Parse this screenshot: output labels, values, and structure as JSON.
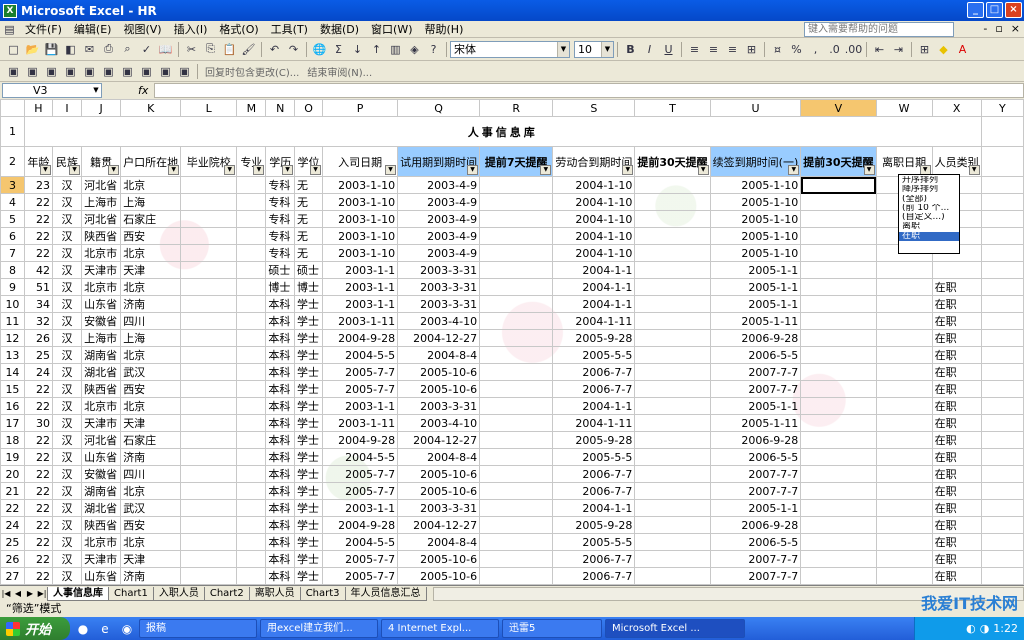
{
  "window": {
    "title": "Microsoft Excel - HR"
  },
  "menu": {
    "items": [
      "文件(F)",
      "编辑(E)",
      "视图(V)",
      "插入(I)",
      "格式(O)",
      "工具(T)",
      "数据(D)",
      "窗口(W)",
      "帮助(H)"
    ],
    "help_placeholder": "键入需要帮助的问题"
  },
  "toolbar": {
    "font_name": "宋体",
    "font_size": "10",
    "review_label": "回复时包含更改(C)...",
    "end_review": "结束审阅(N)..."
  },
  "formula_bar": {
    "name_box": "V3",
    "fx": "fx"
  },
  "columns": [
    "H",
    "I",
    "J",
    "K",
    "L",
    "M",
    "N",
    "O",
    "P",
    "Q",
    "R",
    "S",
    "T",
    "U",
    "V",
    "W",
    "X",
    "Y"
  ],
  "selected_column": "V",
  "sheet": {
    "title": "人事信息库",
    "headers": [
      {
        "col": "H",
        "text": "年龄",
        "style": "orange"
      },
      {
        "col": "I",
        "text": "民族",
        "style": "orange"
      },
      {
        "col": "J",
        "text": "籍贯",
        "style": "orange"
      },
      {
        "col": "K",
        "text": "户口所在地",
        "style": "orange"
      },
      {
        "col": "L",
        "text": "毕业院校",
        "style": "orange"
      },
      {
        "col": "M",
        "text": "专业",
        "style": "orange"
      },
      {
        "col": "N",
        "text": "学历",
        "style": "orange"
      },
      {
        "col": "O",
        "text": "学位",
        "style": "orange"
      },
      {
        "col": "P",
        "text": "入司日期",
        "style": "orange"
      },
      {
        "col": "Q",
        "text": "试用期到期时间",
        "style": "blue"
      },
      {
        "col": "R",
        "text": "提前7天提醒",
        "style": "blue-bold",
        "red": "7"
      },
      {
        "col": "S",
        "text": "劳动合到期时间",
        "style": "orange"
      },
      {
        "col": "T",
        "text": "提前30天提醒",
        "style": "orange-bold",
        "red": "30"
      },
      {
        "col": "U",
        "text": "续签到期时间(一)",
        "style": "blue"
      },
      {
        "col": "V",
        "text": "提前30天提醒",
        "style": "blue-bold",
        "red": "30"
      },
      {
        "col": "W",
        "text": "离职日期",
        "style": "orange"
      },
      {
        "col": "X",
        "text": "人员类别",
        "style": "orange"
      }
    ],
    "rows": [
      {
        "n": "3",
        "age": "23",
        "eth": "汉",
        "native": "河北省",
        "hukou": "北京",
        "edu": "专科",
        "deg": "无",
        "join": "2003-1-10",
        "trial": "2003-4-9",
        "contract": "2004-1-10",
        "renew": "2005-1-10",
        "cat": ""
      },
      {
        "n": "4",
        "age": "22",
        "eth": "汉",
        "native": "上海市",
        "hukou": "上海",
        "edu": "专科",
        "deg": "无",
        "join": "2003-1-10",
        "trial": "2003-4-9",
        "contract": "2004-1-10",
        "renew": "2005-1-10",
        "cat": ""
      },
      {
        "n": "5",
        "age": "22",
        "eth": "汉",
        "native": "河北省",
        "hukou": "石家庄",
        "edu": "专科",
        "deg": "无",
        "join": "2003-1-10",
        "trial": "2003-4-9",
        "contract": "2004-1-10",
        "renew": "2005-1-10",
        "cat": ""
      },
      {
        "n": "6",
        "age": "22",
        "eth": "汉",
        "native": "陕西省",
        "hukou": "西安",
        "edu": "专科",
        "deg": "无",
        "join": "2003-1-10",
        "trial": "2003-4-9",
        "contract": "2004-1-10",
        "renew": "2005-1-10",
        "cat": ""
      },
      {
        "n": "7",
        "age": "22",
        "eth": "汉",
        "native": "北京市",
        "hukou": "北京",
        "edu": "专科",
        "deg": "无",
        "join": "2003-1-10",
        "trial": "2003-4-9",
        "contract": "2004-1-10",
        "renew": "2005-1-10",
        "cat": ""
      },
      {
        "n": "8",
        "age": "42",
        "eth": "汉",
        "native": "天津市",
        "hukou": "天津",
        "edu": "硕士",
        "deg": "硕士",
        "join": "2003-1-1",
        "trial": "2003-3-31",
        "contract": "2004-1-1",
        "renew": "2005-1-1",
        "cat": ""
      },
      {
        "n": "9",
        "age": "51",
        "eth": "汉",
        "native": "北京市",
        "hukou": "北京",
        "edu": "博士",
        "deg": "博士",
        "join": "2003-1-1",
        "trial": "2003-3-31",
        "contract": "2004-1-1",
        "renew": "2005-1-1",
        "cat": "在职"
      },
      {
        "n": "10",
        "age": "34",
        "eth": "汉",
        "native": "山东省",
        "hukou": "济南",
        "edu": "本科",
        "deg": "学士",
        "join": "2003-1-1",
        "trial": "2003-3-31",
        "contract": "2004-1-1",
        "renew": "2005-1-1",
        "cat": "在职"
      },
      {
        "n": "11",
        "age": "32",
        "eth": "汉",
        "native": "安徽省",
        "hukou": "四川",
        "edu": "本科",
        "deg": "学士",
        "join": "2003-1-11",
        "trial": "2003-4-10",
        "contract": "2004-1-11",
        "renew": "2005-1-11",
        "cat": "在职"
      },
      {
        "n": "12",
        "age": "26",
        "eth": "汉",
        "native": "上海市",
        "hukou": "上海",
        "edu": "本科",
        "deg": "学士",
        "join": "2004-9-28",
        "trial": "2004-12-27",
        "contract": "2005-9-28",
        "renew": "2006-9-28",
        "cat": "在职"
      },
      {
        "n": "13",
        "age": "25",
        "eth": "汉",
        "native": "湖南省",
        "hukou": "北京",
        "edu": "本科",
        "deg": "学士",
        "join": "2004-5-5",
        "trial": "2004-8-4",
        "contract": "2005-5-5",
        "renew": "2006-5-5",
        "cat": "在职"
      },
      {
        "n": "14",
        "age": "24",
        "eth": "汉",
        "native": "湖北省",
        "hukou": "武汉",
        "edu": "本科",
        "deg": "学士",
        "join": "2005-7-7",
        "trial": "2005-10-6",
        "contract": "2006-7-7",
        "renew": "2007-7-7",
        "cat": "在职"
      },
      {
        "n": "15",
        "age": "22",
        "eth": "汉",
        "native": "陕西省",
        "hukou": "西安",
        "edu": "本科",
        "deg": "学士",
        "join": "2005-7-7",
        "trial": "2005-10-6",
        "contract": "2006-7-7",
        "renew": "2007-7-7",
        "cat": "在职"
      },
      {
        "n": "16",
        "age": "22",
        "eth": "汉",
        "native": "北京市",
        "hukou": "北京",
        "edu": "本科",
        "deg": "学士",
        "join": "2003-1-1",
        "trial": "2003-3-31",
        "contract": "2004-1-1",
        "renew": "2005-1-1",
        "cat": "在职"
      },
      {
        "n": "17",
        "age": "30",
        "eth": "汉",
        "native": "天津市",
        "hukou": "天津",
        "edu": "本科",
        "deg": "学士",
        "join": "2003-1-11",
        "trial": "2003-4-10",
        "contract": "2004-1-11",
        "renew": "2005-1-11",
        "cat": "在职"
      },
      {
        "n": "18",
        "age": "22",
        "eth": "汉",
        "native": "河北省",
        "hukou": "石家庄",
        "edu": "本科",
        "deg": "学士",
        "join": "2004-9-28",
        "trial": "2004-12-27",
        "contract": "2005-9-28",
        "renew": "2006-9-28",
        "cat": "在职"
      },
      {
        "n": "19",
        "age": "22",
        "eth": "汉",
        "native": "山东省",
        "hukou": "济南",
        "edu": "本科",
        "deg": "学士",
        "join": "2004-5-5",
        "trial": "2004-8-4",
        "contract": "2005-5-5",
        "renew": "2006-5-5",
        "cat": "在职"
      },
      {
        "n": "20",
        "age": "22",
        "eth": "汉",
        "native": "安徽省",
        "hukou": "四川",
        "edu": "本科",
        "deg": "学士",
        "join": "2005-7-7",
        "trial": "2005-10-6",
        "contract": "2006-7-7",
        "renew": "2007-7-7",
        "cat": "在职"
      },
      {
        "n": "21",
        "age": "22",
        "eth": "汉",
        "native": "湖南省",
        "hukou": "北京",
        "edu": "本科",
        "deg": "学士",
        "join": "2005-7-7",
        "trial": "2005-10-6",
        "contract": "2006-7-7",
        "renew": "2007-7-7",
        "cat": "在职"
      },
      {
        "n": "22",
        "age": "22",
        "eth": "汉",
        "native": "湖北省",
        "hukou": "武汉",
        "edu": "本科",
        "deg": "学士",
        "join": "2003-1-1",
        "trial": "2003-3-31",
        "contract": "2004-1-1",
        "renew": "2005-1-1",
        "cat": "在职"
      },
      {
        "n": "24",
        "age": "22",
        "eth": "汉",
        "native": "陕西省",
        "hukou": "西安",
        "edu": "本科",
        "deg": "学士",
        "join": "2004-9-28",
        "trial": "2004-12-27",
        "contract": "2005-9-28",
        "renew": "2006-9-28",
        "cat": "在职"
      },
      {
        "n": "25",
        "age": "22",
        "eth": "汉",
        "native": "北京市",
        "hukou": "北京",
        "edu": "本科",
        "deg": "学士",
        "join": "2004-5-5",
        "trial": "2004-8-4",
        "contract": "2005-5-5",
        "renew": "2006-5-5",
        "cat": "在职"
      },
      {
        "n": "26",
        "age": "22",
        "eth": "汉",
        "native": "天津市",
        "hukou": "天津",
        "edu": "本科",
        "deg": "学士",
        "join": "2005-7-7",
        "trial": "2005-10-6",
        "contract": "2006-7-7",
        "renew": "2007-7-7",
        "cat": "在职"
      },
      {
        "n": "27",
        "age": "22",
        "eth": "汉",
        "native": "山东省",
        "hukou": "济南",
        "edu": "本科",
        "deg": "学士",
        "join": "2005-7-7",
        "trial": "2005-10-6",
        "contract": "2006-7-7",
        "renew": "2007-7-7",
        "cat": "在职"
      },
      {
        "n": "28",
        "age": "22",
        "eth": "汉",
        "native": "安徽省",
        "hukou": "四川",
        "edu": "本科",
        "deg": "学士",
        "join": "2003-1-1",
        "trial": "2003-3-31",
        "contract": "2004-1-1",
        "renew": "2005-1-1",
        "cat": "在职"
      }
    ]
  },
  "filter_dropdown": {
    "options": [
      "升序排列",
      "降序排列",
      "",
      "(全部)",
      "(前 10 个...",
      "(自定义...)",
      "离职",
      "在职"
    ],
    "highlighted": "在职"
  },
  "sheet_tabs": [
    "人事信息库",
    "Chart1",
    "入职人员",
    "Chart2",
    "离职人员",
    "Chart3",
    "年人员信息汇总"
  ],
  "active_tab": "人事信息库",
  "status": {
    "text": "“筛选”模式"
  },
  "taskbar": {
    "start": "开始",
    "tasks": [
      "报稿",
      "用excel建立我们...",
      "4 Internet Expl...",
      "迅雷5",
      "Microsoft Excel ..."
    ],
    "active_task": "Microsoft Excel ...",
    "clock": "1:22"
  },
  "watermark": "我爱IT技术网"
}
